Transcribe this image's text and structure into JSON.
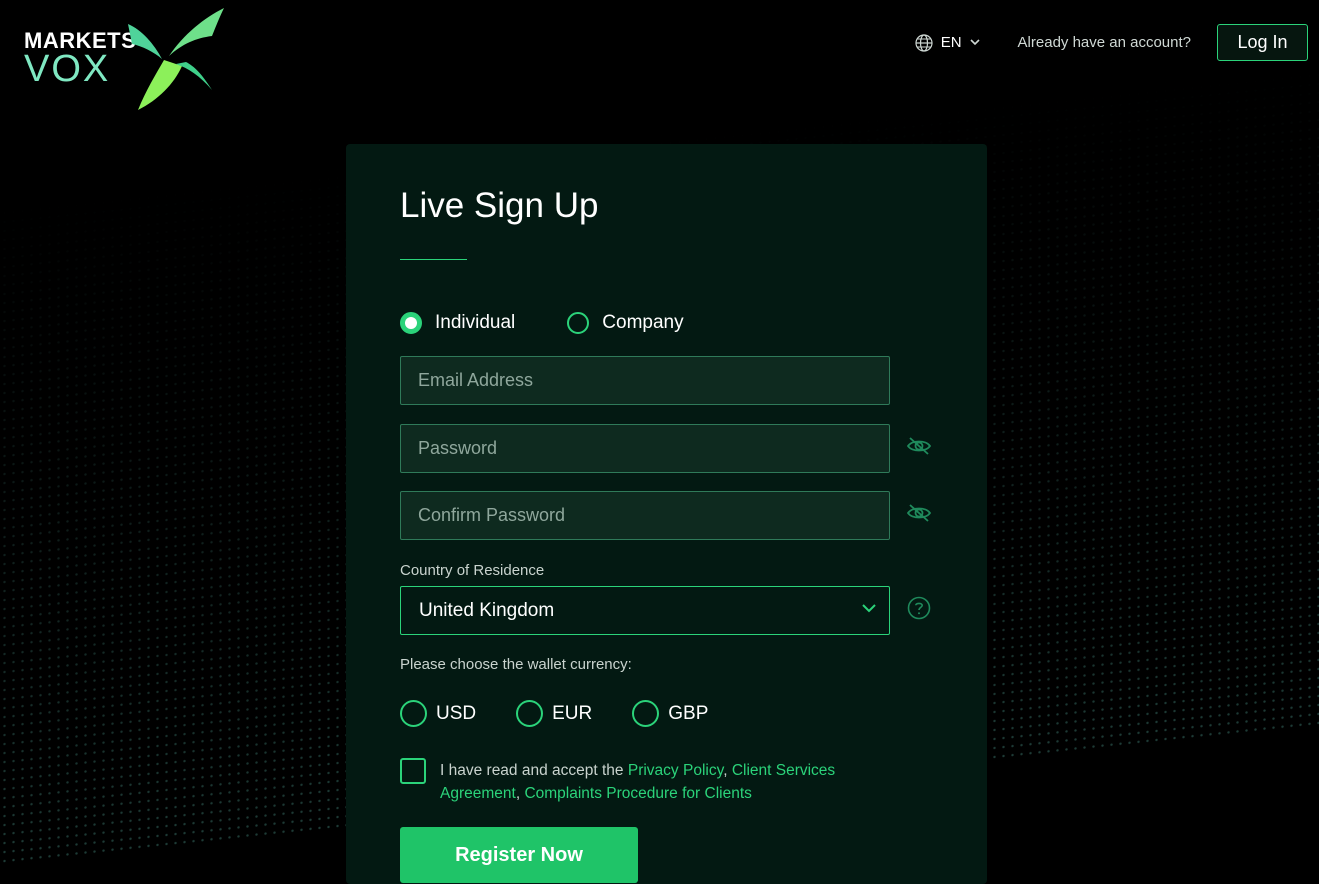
{
  "brand": {
    "line1": "MARKETS",
    "line2": "VOX"
  },
  "header": {
    "language": "EN",
    "already_text": "Already have an account?",
    "login_label": "Log In"
  },
  "form": {
    "title": "Live Sign Up",
    "account_type": {
      "options": [
        "Individual",
        "Company"
      ],
      "selected": "Individual"
    },
    "email_placeholder": "Email Address",
    "password_placeholder": "Password",
    "confirm_password_placeholder": "Confirm Password",
    "country_label": "Country of Residence",
    "country_value": "United Kingdom",
    "wallet_label": "Please choose the wallet currency:",
    "currencies": [
      "USD",
      "EUR",
      "GBP"
    ],
    "terms": {
      "prefix": "I have read and accept the ",
      "link1": "Privacy Policy",
      "sep1": ", ",
      "link2": "Client Services Agreement",
      "sep2": ", ",
      "link3": "Complaints Procedure for Clients"
    },
    "register_label": "Register Now"
  },
  "colors": {
    "accent": "#2bd37a",
    "card_bg": "#031912",
    "input_bg": "#0e2a1f",
    "button_bg": "#1fc468"
  },
  "icons": [
    "globe-icon",
    "chevron-down-icon",
    "eye-off-icon",
    "help-icon"
  ]
}
